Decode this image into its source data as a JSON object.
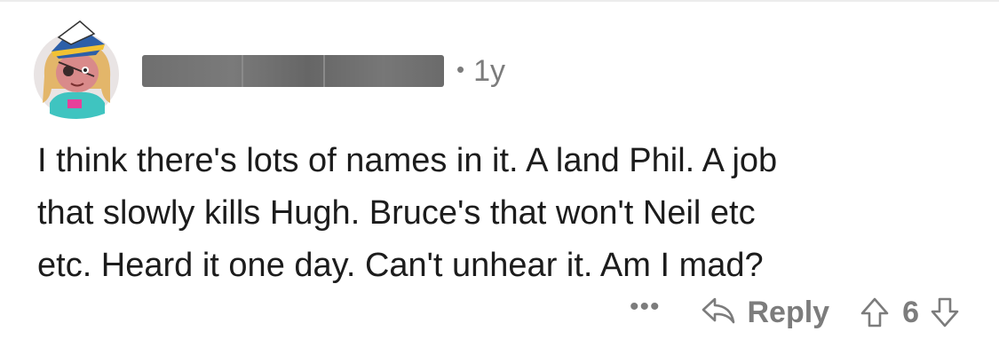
{
  "comment": {
    "timestamp": "1y",
    "separator": "•",
    "body_lines": [
      "I think there's lots of names in it. A land Phil. A job",
      "that slowly kills Hugh. Bruce's that won't Neil etc",
      "etc. Heard it one day. Can't unhear it. Am I mad?"
    ]
  },
  "actions": {
    "more_label": "•••",
    "reply_label": "Reply",
    "score": "6"
  },
  "icons": {
    "reply": "reply-arrow-icon",
    "upvote": "upvote-arrow-icon",
    "downvote": "downvote-arrow-icon"
  },
  "colors": {
    "text": "#1c1c1c",
    "muted": "#7c7c7c",
    "redaction": "#6f6f6f"
  }
}
